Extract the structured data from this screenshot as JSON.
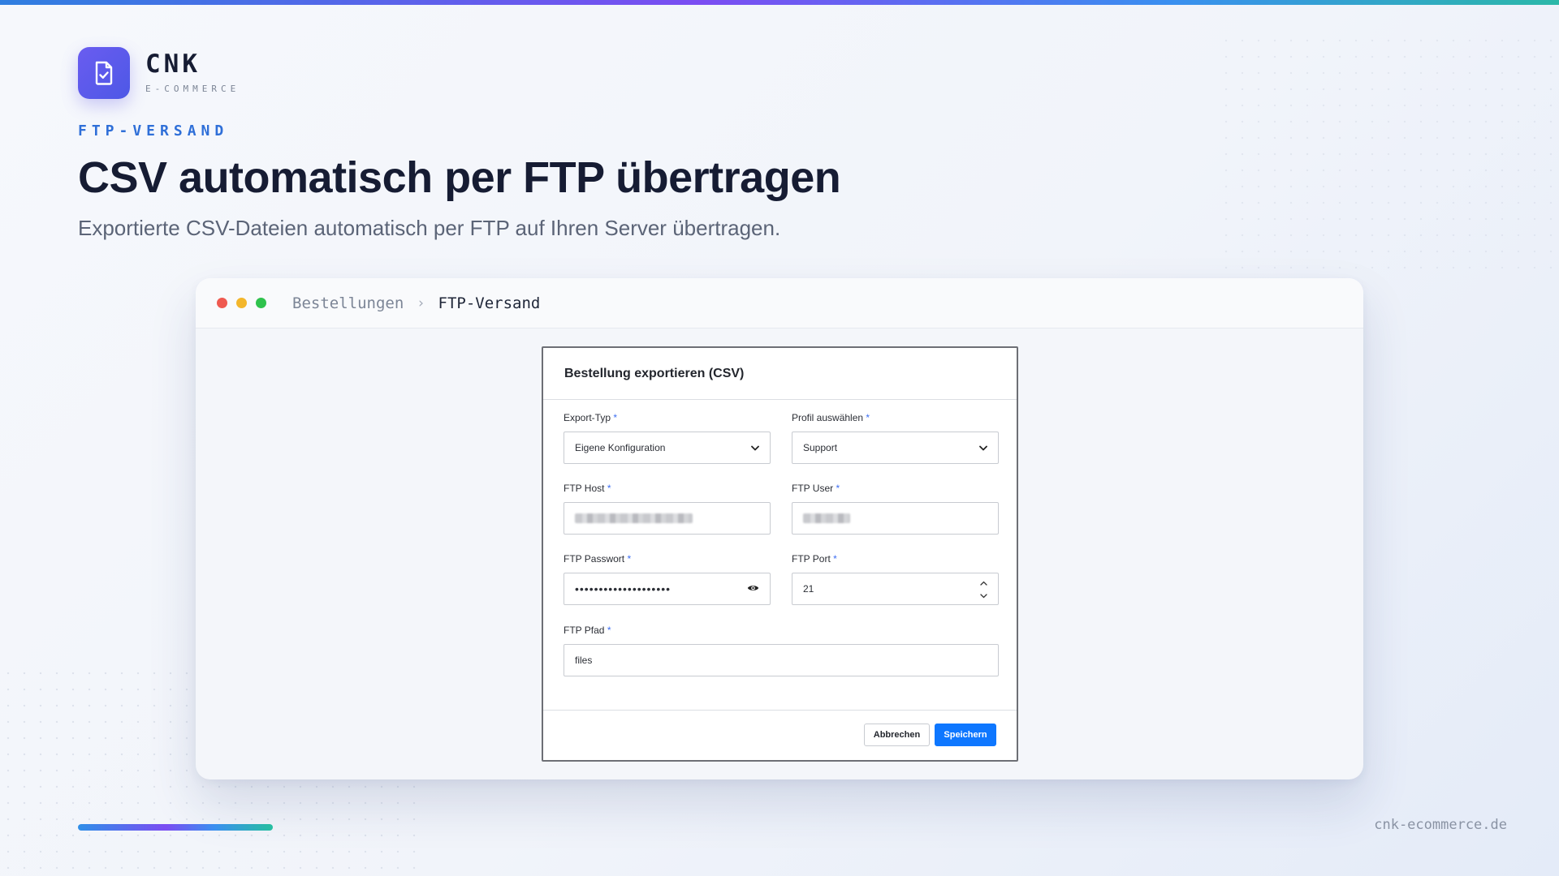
{
  "brand": {
    "name": "CNK",
    "tagline": "E-COMMERCE",
    "logo_icon": "document-check-icon",
    "accent": "#5a57ec"
  },
  "hero": {
    "eyebrow": "FTP-VERSAND",
    "title": "CSV automatisch per FTP übertragen",
    "subtitle": "Exportierte CSV-Dateien automatisch per FTP auf Ihren Server übertragen."
  },
  "window": {
    "breadcrumb": {
      "parent": "Bestellungen",
      "separator": "›",
      "current": "FTP-Versand"
    },
    "traffic_lights": [
      "#ef5a50",
      "#f3b62b",
      "#2fc24d"
    ]
  },
  "modal": {
    "title": "Bestellung exportieren (CSV)",
    "required_marker": "*",
    "fields": {
      "export_type": {
        "label": "Export-Typ",
        "value": "Eigene Konfiguration"
      },
      "profile": {
        "label": "Profil auswählen",
        "value": "Support"
      },
      "ftp_host": {
        "label": "FTP Host",
        "value_state": "blurred"
      },
      "ftp_user": {
        "label": "FTP User",
        "value_state": "blurred"
      },
      "ftp_password": {
        "label": "FTP Passwort",
        "masked_value": "••••••••••••••••••••"
      },
      "ftp_port": {
        "label": "FTP Port",
        "value": "21"
      },
      "ftp_path": {
        "label": "FTP Pfad",
        "value": "files"
      }
    },
    "buttons": {
      "cancel": "Abbrechen",
      "save": "Speichern",
      "save_color": "#0e77ff"
    }
  },
  "footer": {
    "url": "cnk-ecommerce.de"
  }
}
